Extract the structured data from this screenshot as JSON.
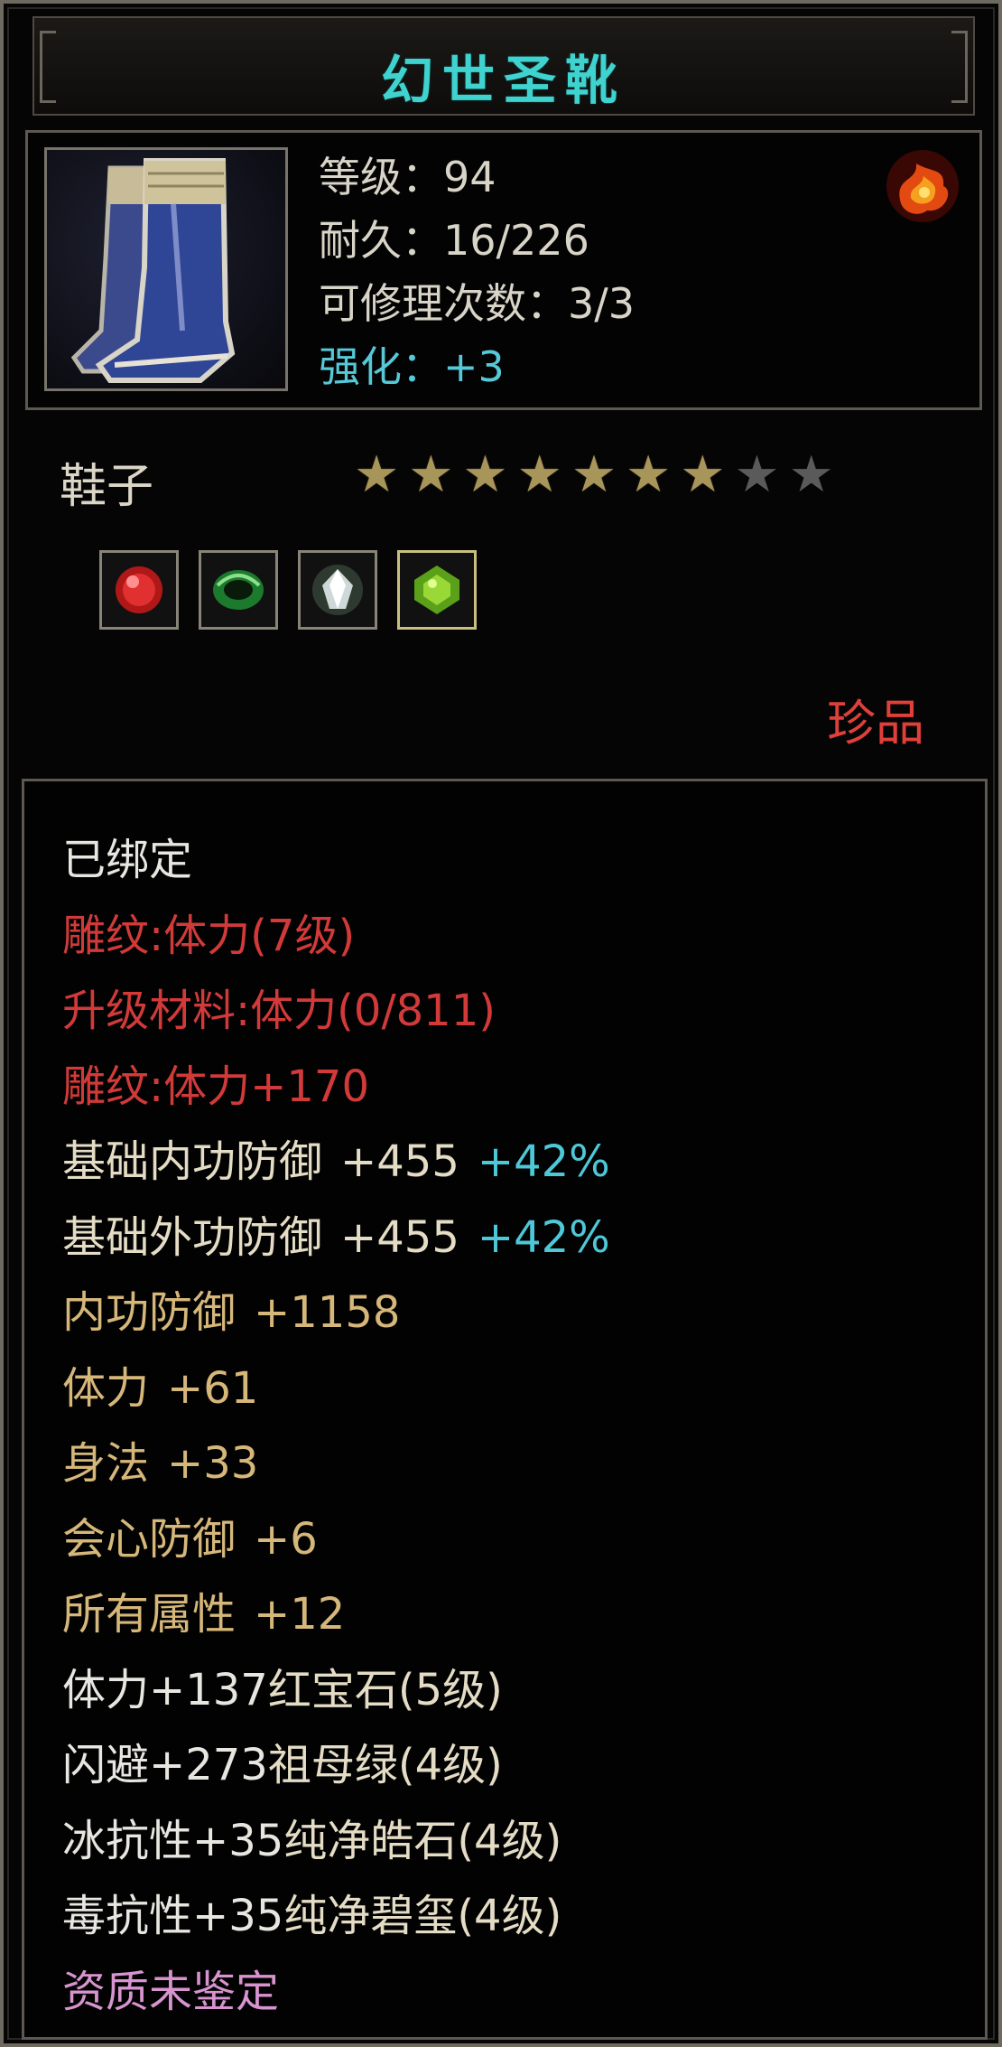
{
  "title": "幻世圣靴",
  "header": {
    "level": "等级：94",
    "durability": "耐久：16/226",
    "repair_count": "可修理次数：3/3",
    "enhance": "强化：+3"
  },
  "item": {
    "type": "鞋子",
    "stars_filled": 7,
    "stars_total": 9,
    "rarity": "珍品",
    "gems": [
      "red-gem-icon",
      "green-jade-icon",
      "white-crystal-icon",
      "green-gem-icon"
    ]
  },
  "attributes": {
    "bound": "已绑定",
    "engrave_level": "雕纹:体力(7级)",
    "upgrade_material": "升级材料:体力(0/811)",
    "engrave_bonus": "雕纹:体力+170",
    "base_inner_def": {
      "name": "基础内功防御",
      "value": "+455",
      "pct": "+42%"
    },
    "base_outer_def": {
      "name": "基础外功防御",
      "value": "+455",
      "pct": "+42%"
    },
    "inner_def": {
      "name": "内功防御",
      "value": "+1158"
    },
    "stamina": {
      "name": "体力",
      "value": "+61"
    },
    "agility": {
      "name": "身法",
      "value": "+33"
    },
    "crit_def": {
      "name": "会心防御",
      "value": "+6"
    },
    "all_attr": {
      "name": "所有属性",
      "value": "+12"
    },
    "gem1": {
      "stat": "体力+137",
      "name": "红宝石(5级)"
    },
    "gem2": {
      "stat": "闪避+273",
      "name": "祖母绿(4级)"
    },
    "gem3": {
      "stat": "冰抗性+35",
      "name": "纯净皓石(4级)"
    },
    "gem4": {
      "stat": "毒抗性+35",
      "name": "纯净碧玺(4级)"
    },
    "aptitude": "资质未鉴定"
  },
  "colors": {
    "title": "#3fd2cf",
    "red": "#d23a3a",
    "gold": "#d6b77a",
    "cyan": "#4ec8d8",
    "pink": "#d894d0"
  }
}
